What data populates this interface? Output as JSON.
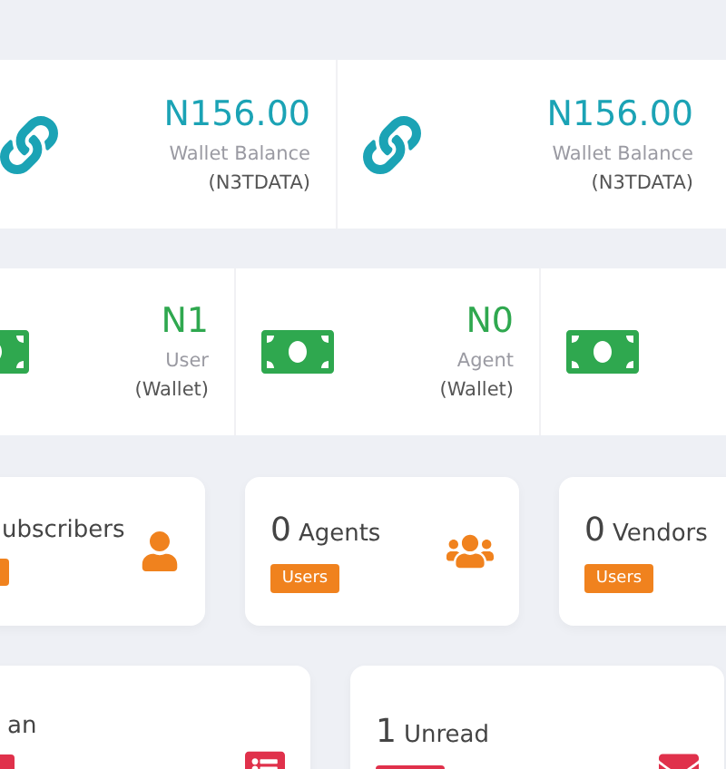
{
  "balances": [
    {
      "amount": "N156.00",
      "label": "Wallet Balance",
      "sub": "(N3TDATA)"
    },
    {
      "amount": "N156.00",
      "label": "Wallet Balance",
      "sub": "(N3TDATA)"
    }
  ],
  "wallets": [
    {
      "kind": "money",
      "amount": "N1",
      "label": "User",
      "sub": "(Wallet)"
    },
    {
      "kind": "money",
      "amount": "N0",
      "label": "Agent",
      "sub": "(Wallet)"
    },
    {
      "kind": "money"
    }
  ],
  "user_cards": [
    {
      "label": "ubscribers",
      "kind": "user",
      "badge": true
    },
    {
      "count": "0",
      "label": "Agents",
      "kind": "users",
      "badge": true,
      "badge_label": "Users"
    },
    {
      "count": "0",
      "label": "Vendors",
      "badge": true,
      "badge_label": "Users"
    }
  ],
  "info_cards": [
    {
      "label": "an",
      "kind": "list",
      "badge": true
    },
    {
      "count": "1",
      "label": "Unread",
      "kind": "mail",
      "badge": true
    }
  ]
}
